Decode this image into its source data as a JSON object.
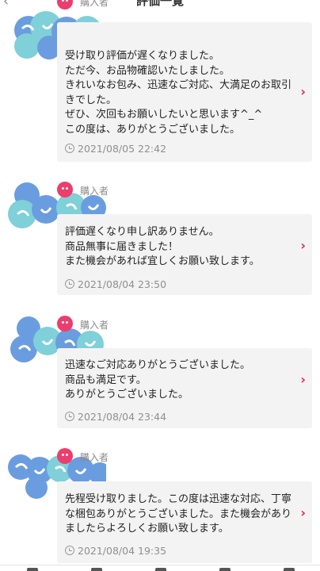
{
  "header": {
    "title": "評価一覧",
    "back_icon": "chevron-left-icon"
  },
  "reviews": [
    {
      "role": "購入者",
      "comment": "受け取り評価が遅くなりました。\nただ今、お品物確認いたしました。\nきれいなお包み、迅速なご対応、大満足のお取引きでした。\nぜひ、次回もお願いしたいと思います^_^\nこの度は、ありがとうございました。",
      "timestamp": "2021/08/05 22:42"
    },
    {
      "role": "購入者",
      "comment": "評価遅くなり申し訳ありません。\n商品無事に届きました！\nまた機会があれば宜しくお願い致します。",
      "timestamp": "2021/08/04 23:50"
    },
    {
      "role": "購入者",
      "comment": "迅速なご対応ありがとうございました。\n商品も満足です。\nありがとうございました。",
      "timestamp": "2021/08/04 23:44"
    },
    {
      "role": "購入者",
      "comment": "先程受け取りました。この度は迅速な対応、丁寧な梱包ありがとうございました。また機会がありましたらよろしくお願い致します。",
      "timestamp": "2021/08/04 19:35"
    }
  ],
  "colors": {
    "accent": "#e0294f",
    "role_icon": "#ec3d6d",
    "bubble_bg": "#f3f3f3",
    "avatar_blue": "#6a9de0",
    "avatar_teal": "#7fd0d8"
  }
}
